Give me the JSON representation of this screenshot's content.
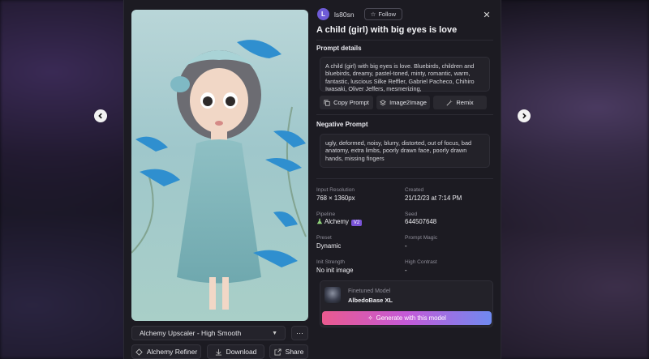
{
  "user": {
    "avatar_letter": "L",
    "name": "ls80sn",
    "follow_label": "Follow"
  },
  "title": "A child (girl) with big eyes is love",
  "prompt_details": {
    "label": "Prompt details",
    "text": "A child (girl) with big eyes is love. Bluebirds, children and bluebirds, dreamy, pastel-toned, minty, romantic, warm, fantastic, luscious Silke Reffler, Gabriel Pacheco, Chihiro Iwasaki, Oliver Jeffers, mesmerizing,",
    "copy_label": "Copy Prompt",
    "img2img_label": "Image2Image",
    "remix_label": "Remix"
  },
  "negative_prompt": {
    "label": "Negative Prompt",
    "text": "ugly, deformed, noisy, blurry, distorted, out of focus, bad anatomy, extra limbs, poorly drawn face, poorly drawn hands, missing fingers"
  },
  "details": {
    "input_resolution_label": "Input Resolution",
    "input_resolution": "768 × 1360px",
    "created_label": "Created",
    "created": "21/12/23 at 7:14 PM",
    "pipeline_label": "Pipeline",
    "pipeline": "Alchemy",
    "pipeline_badge": "V2",
    "seed_label": "Seed",
    "seed": "644507648",
    "preset_label": "Preset",
    "preset": "Dynamic",
    "prompt_magic_label": "Prompt Magic",
    "prompt_magic": "-",
    "init_strength_label": "Init Strength",
    "init_strength": "No init image",
    "high_contrast_label": "High Contrast",
    "high_contrast": "-"
  },
  "model": {
    "label": "Finetuned Model",
    "name": "AlbedoBase XL",
    "generate_label": "Generate with this model"
  },
  "image_actions": {
    "upscaler": "Alchemy Upscaler - High Smooth",
    "refiner": "Alchemy Refiner",
    "download": "Download",
    "share": "Share"
  },
  "colors": {
    "accent_gradient_start": "#ea5a8f",
    "accent_gradient_end": "#6f8af0",
    "avatar": "#6e5bd6",
    "badge": "#7a54d8"
  },
  "icons": [
    "chevron-left-icon",
    "chevron-right-icon",
    "close-icon",
    "star-icon",
    "copy-icon",
    "layers-icon",
    "wand-icon",
    "flask-icon",
    "refiner-icon",
    "download-icon",
    "share-icon",
    "more-icon",
    "caret-down-icon",
    "sparkle-icon"
  ]
}
